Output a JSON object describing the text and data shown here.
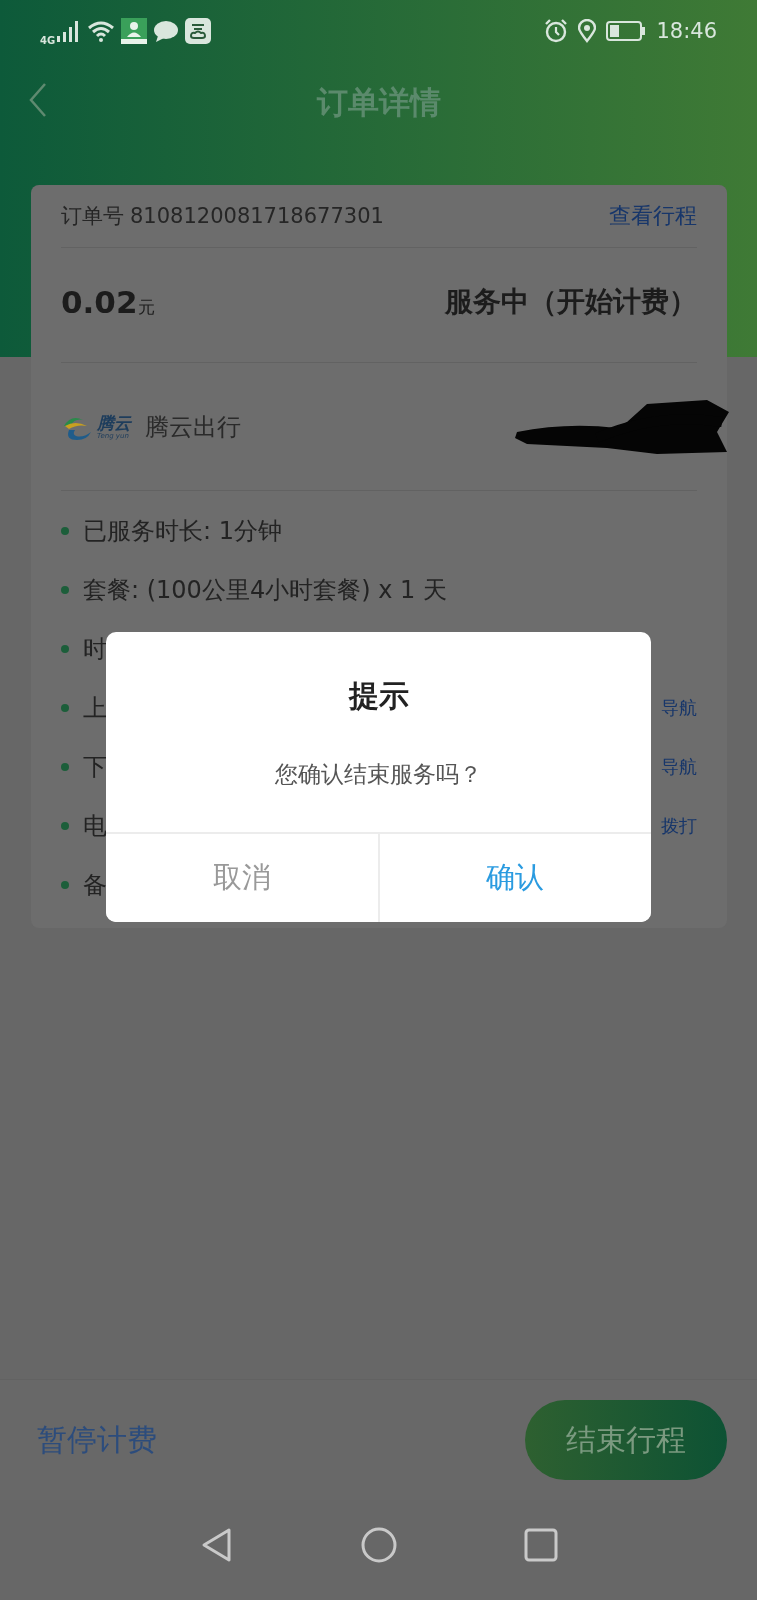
{
  "status_bar": {
    "network": "4G",
    "time": "18:46"
  },
  "header": {
    "title": "订单详情"
  },
  "order": {
    "label": "订单号",
    "number": "8108120081718677301",
    "link": "查看行程",
    "price": "0.02",
    "unit": "元",
    "status": "服务中（开始计费）"
  },
  "company": {
    "logo_name": "腾云",
    "logo_subtitle": "Teng yun",
    "name": "腾云出行"
  },
  "details": [
    {
      "text": "已服务时长: 1分钟"
    },
    {
      "text": "套餐: (100公里4小时套餐) x 1 天"
    },
    {
      "text": "时"
    },
    {
      "text": "上",
      "action": "导航"
    },
    {
      "text": "下",
      "action": "导航"
    },
    {
      "text": "电",
      "action": "拨打"
    },
    {
      "text": "备"
    }
  ],
  "dialog": {
    "title": "提示",
    "message": "您确认结束服务吗？",
    "buttons": [
      {
        "label": "取消",
        "kind": "cancel"
      },
      {
        "label": "确认",
        "kind": "confirm"
      }
    ]
  },
  "bottom": {
    "pause": "暂停计费",
    "end": "结束行程"
  }
}
